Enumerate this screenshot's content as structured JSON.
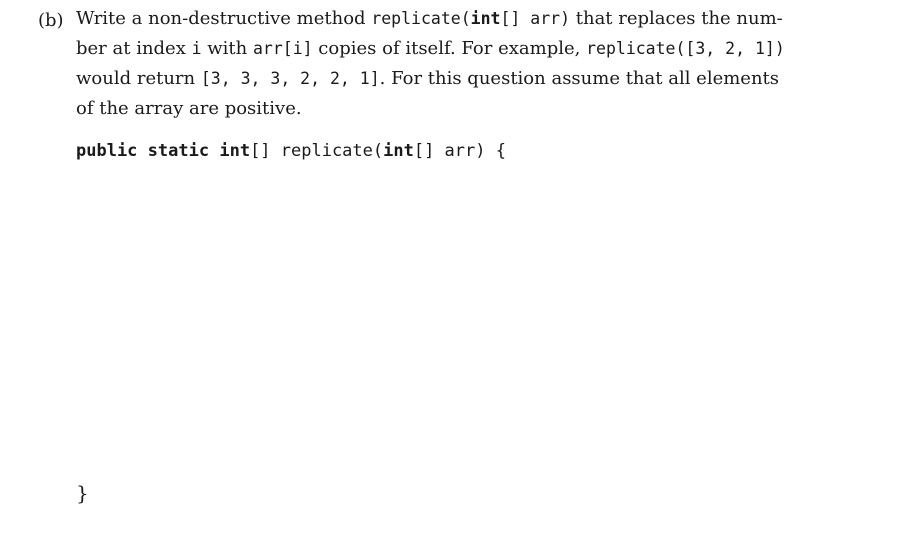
{
  "question": {
    "part_label": "(b)",
    "line1": {
      "t1": "Write a non-destructive method ",
      "code_method": "replicate(",
      "code_type": "int",
      "code_rest": "[] arr)",
      "t2": " that replaces the num-"
    },
    "line2": {
      "t1": "ber at index ",
      "code_i": "i",
      "t2": " with ",
      "code_arr": "arr[i]",
      "t3": " copies of itself. For example, ",
      "code_example": "replicate([3, 2, 1])"
    },
    "line3": {
      "t1": "would return ",
      "code_result": "[3, 3, 3, 2, 2, 1]",
      "t2": ". For this question assume that all elements"
    },
    "line4": {
      "t1": "of the array are positive."
    }
  },
  "code": {
    "kw_public": "public",
    "kw_static": "static",
    "kw_int": "int",
    "sig_mid": "[] replicate(",
    "kw_int2": "int",
    "sig_end": "[] arr) {",
    "closing_brace": "}"
  }
}
